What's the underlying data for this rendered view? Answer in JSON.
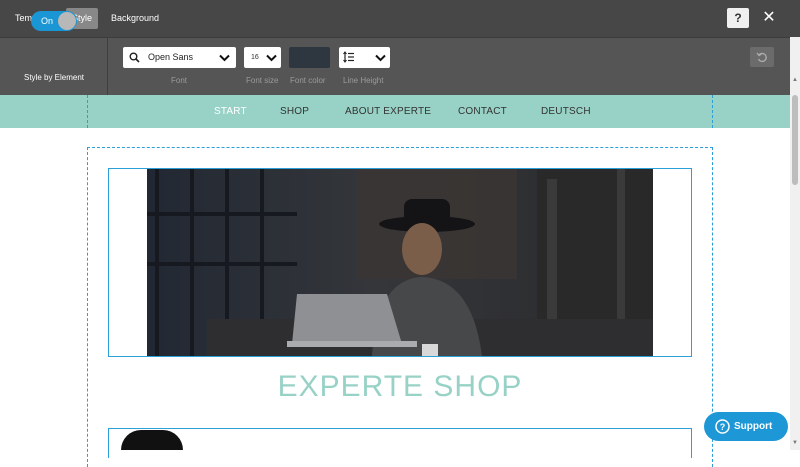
{
  "topbar": {
    "tabs": [
      {
        "label": "Templates",
        "active": false
      },
      {
        "label": "Style",
        "active": true
      },
      {
        "label": "Background",
        "active": false
      }
    ],
    "help_label": "?",
    "close_label": "✕"
  },
  "toolbar": {
    "toggle_label": "On",
    "toggle_state": true,
    "style_by_element_label": "Style by Element",
    "font_value": "Open Sans",
    "font_label": "Font",
    "font_size_value": "16",
    "font_size_label": "Font size",
    "font_color_value": "#2e3640",
    "font_color_label": "Font color",
    "line_height_label": "Line Height"
  },
  "nav": {
    "items": [
      {
        "label": "START",
        "active": true
      },
      {
        "label": "SHOP",
        "active": false
      },
      {
        "label": "ABOUT EXPERTE",
        "active": false
      },
      {
        "label": "CONTACT",
        "active": false
      },
      {
        "label": "DEUTSCH",
        "active": false
      }
    ],
    "background_color": "#98d2c6"
  },
  "main": {
    "title": "EXPERTE SHOP"
  },
  "support": {
    "label": "Support"
  },
  "colors": {
    "accent": "#1d97d6",
    "selection_outline": "#2c9ed8",
    "title_color": "#98d2c6"
  }
}
